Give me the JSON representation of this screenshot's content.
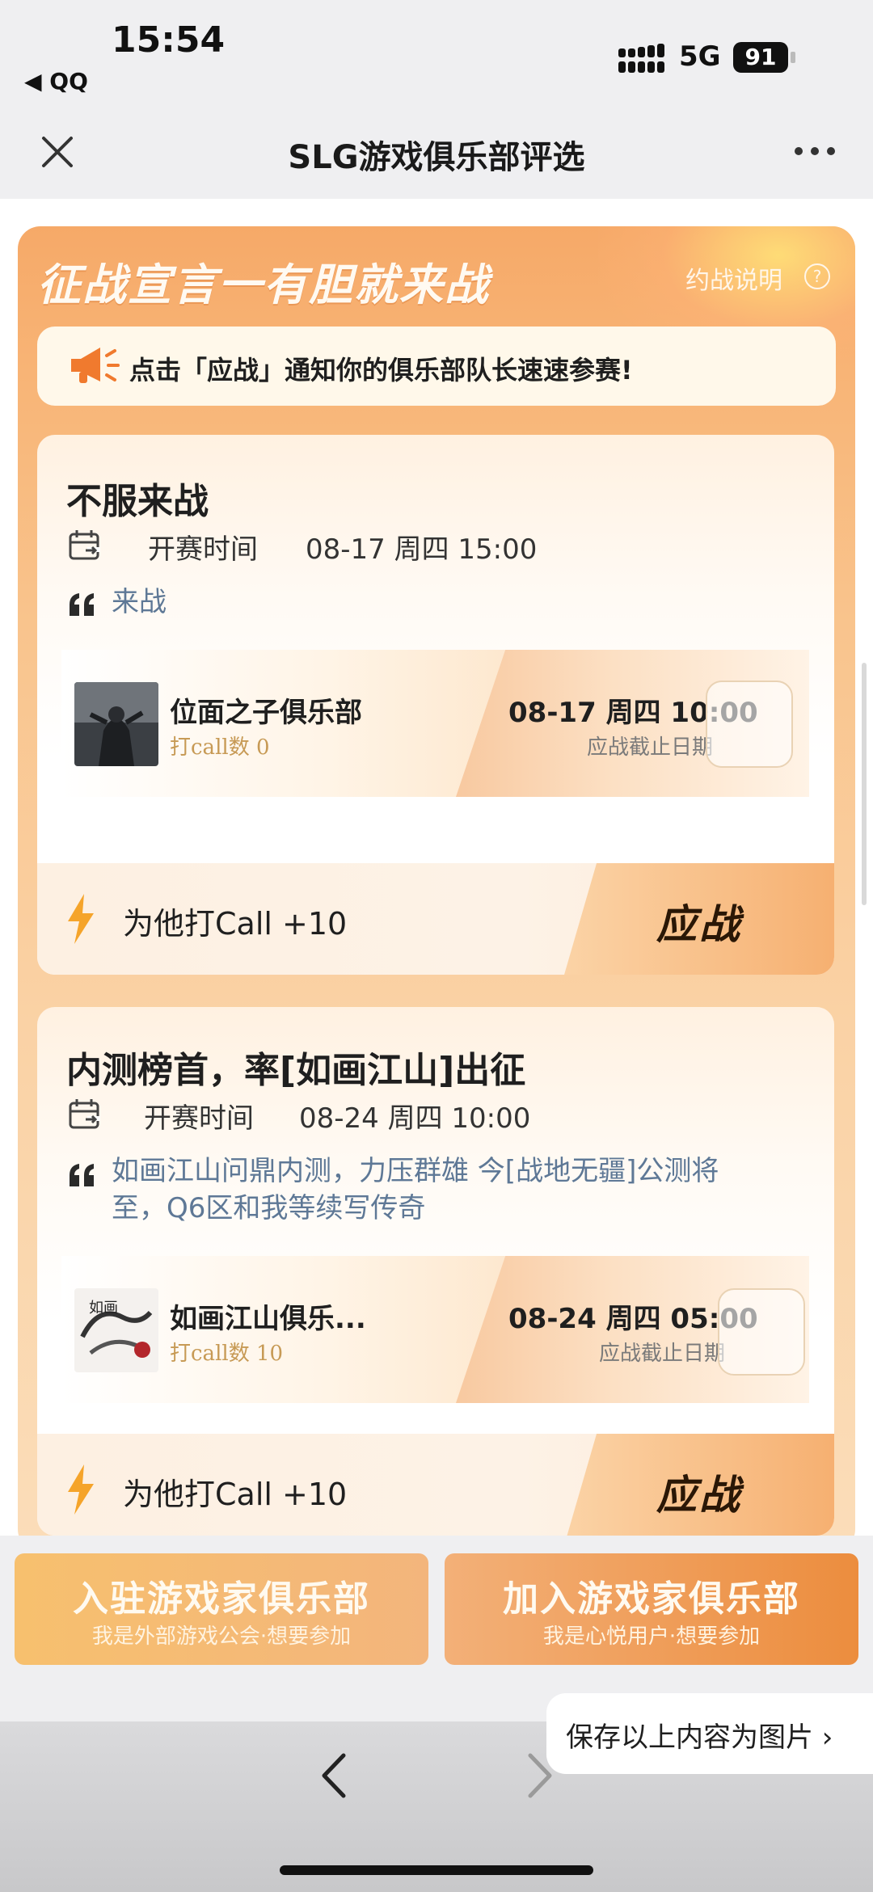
{
  "status_bar": {
    "time": "15:54",
    "back_app": "◀ QQ",
    "network": "5G",
    "battery": "91"
  },
  "nav": {
    "title": "SLG游戏俱乐部评选"
  },
  "banner": {
    "title": "征战宣言一有胆就来战",
    "rules_link": "约战说明",
    "rules_icon": "?",
    "notice": "点击「应战」通知你的俱乐部队长速速参赛!"
  },
  "cards": [
    {
      "title": "不服来战",
      "time_label": "开赛时间",
      "time_value": "08-17 周四 15:00",
      "quote": "来战",
      "club_name": "位面之子俱乐部",
      "call_count": "打call数 0",
      "deadline_date": "08-17 周四 10:00",
      "deadline_label": "应战截止日期",
      "call_action": "为他打Call +10",
      "accept": "应战"
    },
    {
      "title": "内测榜首，率[如画江山]出征",
      "time_label": "开赛时间",
      "time_value": "08-24 周四 10:00",
      "quote_line1": "如画江山问鼎内测，力压群雄 今[战地无疆]公测将",
      "quote_line2": "至，Q6区和我等续写传奇",
      "club_name": "如画江山俱乐部",
      "club_name_display": "如画江山俱乐...",
      "call_count": "打call数 10",
      "deadline_date": "08-24 周四 05:00",
      "deadline_label": "应战截止日期",
      "call_action": "为他打Call +10",
      "accept": "应战"
    }
  ],
  "bottom_buttons": {
    "enter_title": "入驻游戏家俱乐部",
    "enter_sub": "我是外部游戏公会·想要参加",
    "join_title": "加入游戏家俱乐部",
    "join_sub": "我是心悦用户·想要参加"
  },
  "save_pill": "保存以上内容为图片 ›",
  "icons": {
    "close": "close-icon",
    "more": "more-icon",
    "calendar": "calendar-icon",
    "quote": "quote-icon",
    "bolt": "lightning-icon",
    "megaphone": "megaphone-icon",
    "back": "back-arrow-icon",
    "forward": "forward-arrow-icon"
  },
  "colors": {
    "accent": "#f6a968",
    "quote_text": "#5e7896",
    "call_count": "#c79a55",
    "join_button": "#ec8d3e"
  }
}
